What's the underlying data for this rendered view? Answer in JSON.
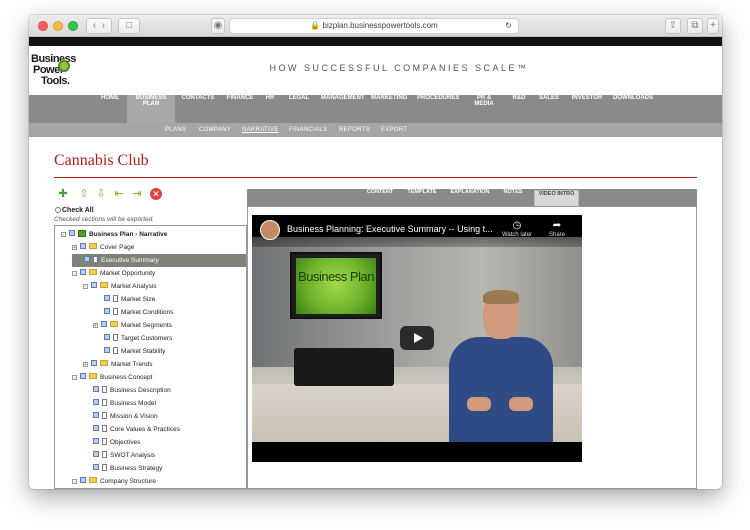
{
  "browser": {
    "url": "bizplan.businesspowertools.com",
    "back_icon": "chevron-left",
    "forward_icon": "chevron-right"
  },
  "site": {
    "logo": [
      "Business",
      "Power",
      "Tools."
    ],
    "tagline": "HOW SUCCESSFUL COMPANIES SCALE™"
  },
  "mainnav": {
    "items": [
      "HOME",
      "BUSINESS PLAN",
      "CONTACTS",
      "FINANCE",
      "HR",
      "LEGAL",
      "MANAGEMENT",
      "MARKETING",
      "PROCEDURES",
      "PR & MEDIA",
      "R&D",
      "SALES",
      "INVESTOR",
      "DOWNLOADS"
    ],
    "active": "BUSINESS PLAN"
  },
  "subnav": {
    "items": [
      "PLANS",
      "COMPANY",
      "NARRATIVE",
      "FINANCIALS",
      "REPORTS",
      "EXPORT"
    ],
    "active": "NARRATIVE"
  },
  "page": {
    "title": "Cannabis Club",
    "check_all": "Check All",
    "checked_note": "Checked sections will be exported."
  },
  "tree": [
    {
      "label": "Business Plan - Narrative",
      "level": 0,
      "type": "root"
    },
    {
      "label": "Cover Page",
      "level": 1,
      "type": "folder"
    },
    {
      "label": "Executive Summary",
      "level": 1,
      "type": "doc",
      "selected": true
    },
    {
      "label": "Market Opportunity",
      "level": 1,
      "type": "folder"
    },
    {
      "label": "Market Analysis",
      "level": 2,
      "type": "folder"
    },
    {
      "label": "Market Size",
      "level": 3,
      "type": "doc"
    },
    {
      "label": "Market Conditions",
      "level": 3,
      "type": "doc"
    },
    {
      "label": "Market Segments",
      "level": 3,
      "type": "folder"
    },
    {
      "label": "Target Customers",
      "level": 3,
      "type": "doc"
    },
    {
      "label": "Market Stability",
      "level": 3,
      "type": "doc"
    },
    {
      "label": "Market Trends",
      "level": 2,
      "type": "folder"
    },
    {
      "label": "Business Concept",
      "level": 1,
      "type": "folder"
    },
    {
      "label": "Business Description",
      "level": 2,
      "type": "doc"
    },
    {
      "label": "Business Model",
      "level": 2,
      "type": "doc"
    },
    {
      "label": "Mission & Vision",
      "level": 2,
      "type": "doc"
    },
    {
      "label": "Core Values & Practices",
      "level": 2,
      "type": "doc"
    },
    {
      "label": "Objectives",
      "level": 2,
      "type": "doc"
    },
    {
      "label": "SWOT Analysis",
      "level": 2,
      "type": "doc"
    },
    {
      "label": "Business Strategy",
      "level": 2,
      "type": "doc"
    },
    {
      "label": "Company Structure",
      "level": 1,
      "type": "folder"
    }
  ],
  "tabs": {
    "items": [
      "CONTENT",
      "TEMPLATE",
      "EXPLANATION",
      "NOTES",
      "VIDEO INTRO"
    ],
    "active": "VIDEO INTRO"
  },
  "video": {
    "title": "Business Planning: Executive Summary -- Using t...",
    "watch_later": "Watch later",
    "share": "Share",
    "screen_text": "Business Plan"
  }
}
